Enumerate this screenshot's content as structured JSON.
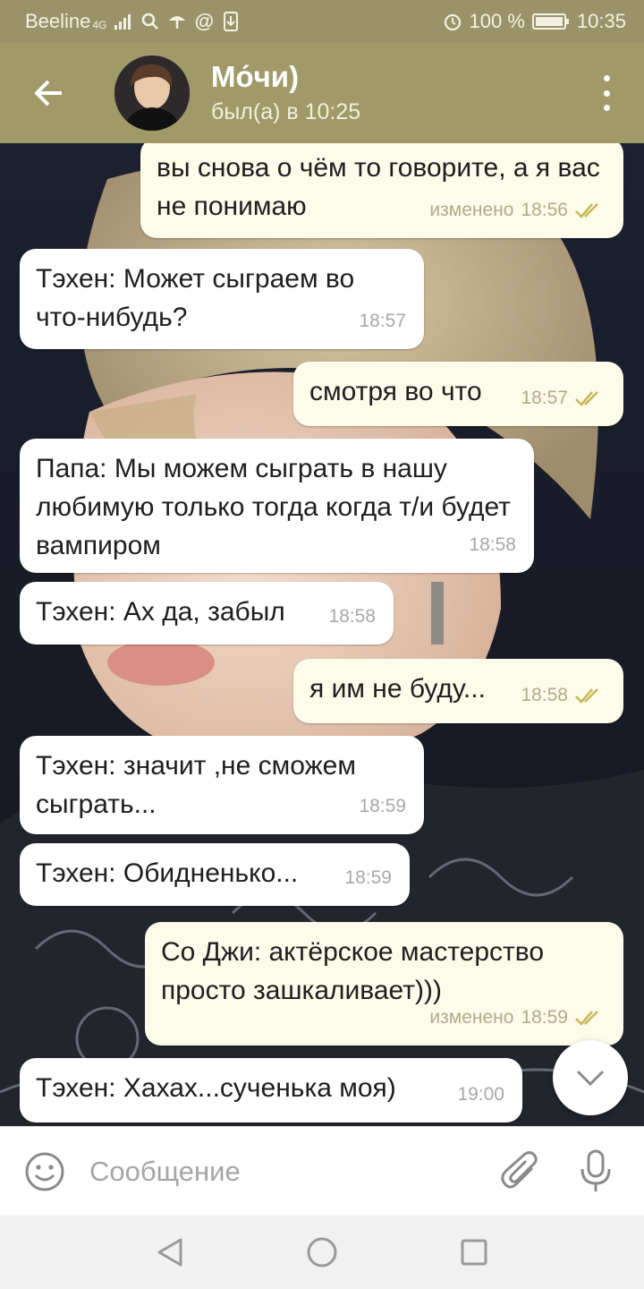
{
  "status_bar": {
    "carrier": "Beeline",
    "network": "4G",
    "battery": "100 %",
    "time": "10:35"
  },
  "header": {
    "back_icon": "arrow-back-icon",
    "title": "Мо́чи)",
    "subtitle": "был(а) в 10:25",
    "menu_icon": "more-vert-icon"
  },
  "messages": [
    {
      "direction": "out",
      "text": "вы снова о чём то говорите, а я вас не понимаю",
      "edited": "изменено",
      "time": "18:56",
      "read": true
    },
    {
      "direction": "in",
      "text": "Тэхен: Может сыграем во что-нибудь?",
      "time": "18:57"
    },
    {
      "direction": "out",
      "text": "смотря во что",
      "time": "18:57",
      "read": true
    },
    {
      "direction": "in",
      "text": "Папа: Мы можем сыграть в нашу любимую только тогда когда т/и будет вампиром",
      "time": "18:58"
    },
    {
      "direction": "in",
      "text": "Тэхен: Ах да, забыл",
      "time": "18:58"
    },
    {
      "direction": "out",
      "text": "я им не буду...",
      "time": "18:58",
      "read": true
    },
    {
      "direction": "in",
      "text": "Тэхен: значит ,не сможем сыграть...",
      "time": "18:59"
    },
    {
      "direction": "in",
      "text": "Тэхен: Обидненько...",
      "time": "18:59"
    },
    {
      "direction": "out",
      "text": "Со Джи: актёрское мастерство просто зашкаливает)))",
      "edited": "изменено",
      "time": "18:59",
      "read": true
    },
    {
      "direction": "in",
      "text": "Тэхен: Хахах...сученька моя)",
      "time": "19:00"
    }
  ],
  "input": {
    "placeholder": "Сообщение",
    "value": ""
  },
  "colors": {
    "header": "#a09968",
    "status_bar": "#9a9369",
    "incoming_bubble": "#ffffff",
    "outgoing_bubble": "#fdfbea",
    "read_ticks": "#c7b85a"
  }
}
